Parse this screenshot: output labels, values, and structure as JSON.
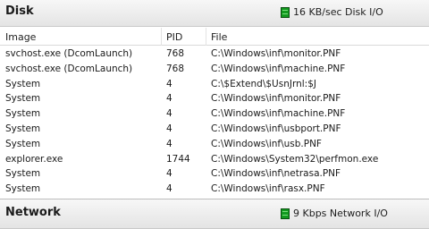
{
  "disk": {
    "title": "Disk",
    "activity_label": "16 KB/sec Disk I/O",
    "columns": [
      "Image",
      "PID",
      "File"
    ],
    "rows": [
      {
        "image": "svchost.exe (DcomLaunch)",
        "pid": "768",
        "file": "C:\\Windows\\inf\\monitor.PNF"
      },
      {
        "image": "svchost.exe (DcomLaunch)",
        "pid": "768",
        "file": "C:\\Windows\\inf\\machine.PNF"
      },
      {
        "image": "System",
        "pid": "4",
        "file": "C:\\$Extend\\$UsnJrnl:$J"
      },
      {
        "image": "System",
        "pid": "4",
        "file": "C:\\Windows\\inf\\monitor.PNF"
      },
      {
        "image": "System",
        "pid": "4",
        "file": "C:\\Windows\\inf\\machine.PNF"
      },
      {
        "image": "System",
        "pid": "4",
        "file": "C:\\Windows\\inf\\usbport.PNF"
      },
      {
        "image": "System",
        "pid": "4",
        "file": "C:\\Windows\\inf\\usb.PNF"
      },
      {
        "image": "explorer.exe",
        "pid": "1744",
        "file": "C:\\Windows\\System32\\perfmon.exe"
      },
      {
        "image": "System",
        "pid": "4",
        "file": "C:\\Windows\\inf\\netrasa.PNF"
      },
      {
        "image": "System",
        "pid": "4",
        "file": "C:\\Windows\\inf\\rasx.PNF"
      }
    ]
  },
  "network": {
    "title": "Network",
    "activity_label": "9 Kbps Network I/O"
  },
  "colors": {
    "activity_led": "#129a1f"
  },
  "icons": {
    "activity": "activity-led-icon"
  }
}
